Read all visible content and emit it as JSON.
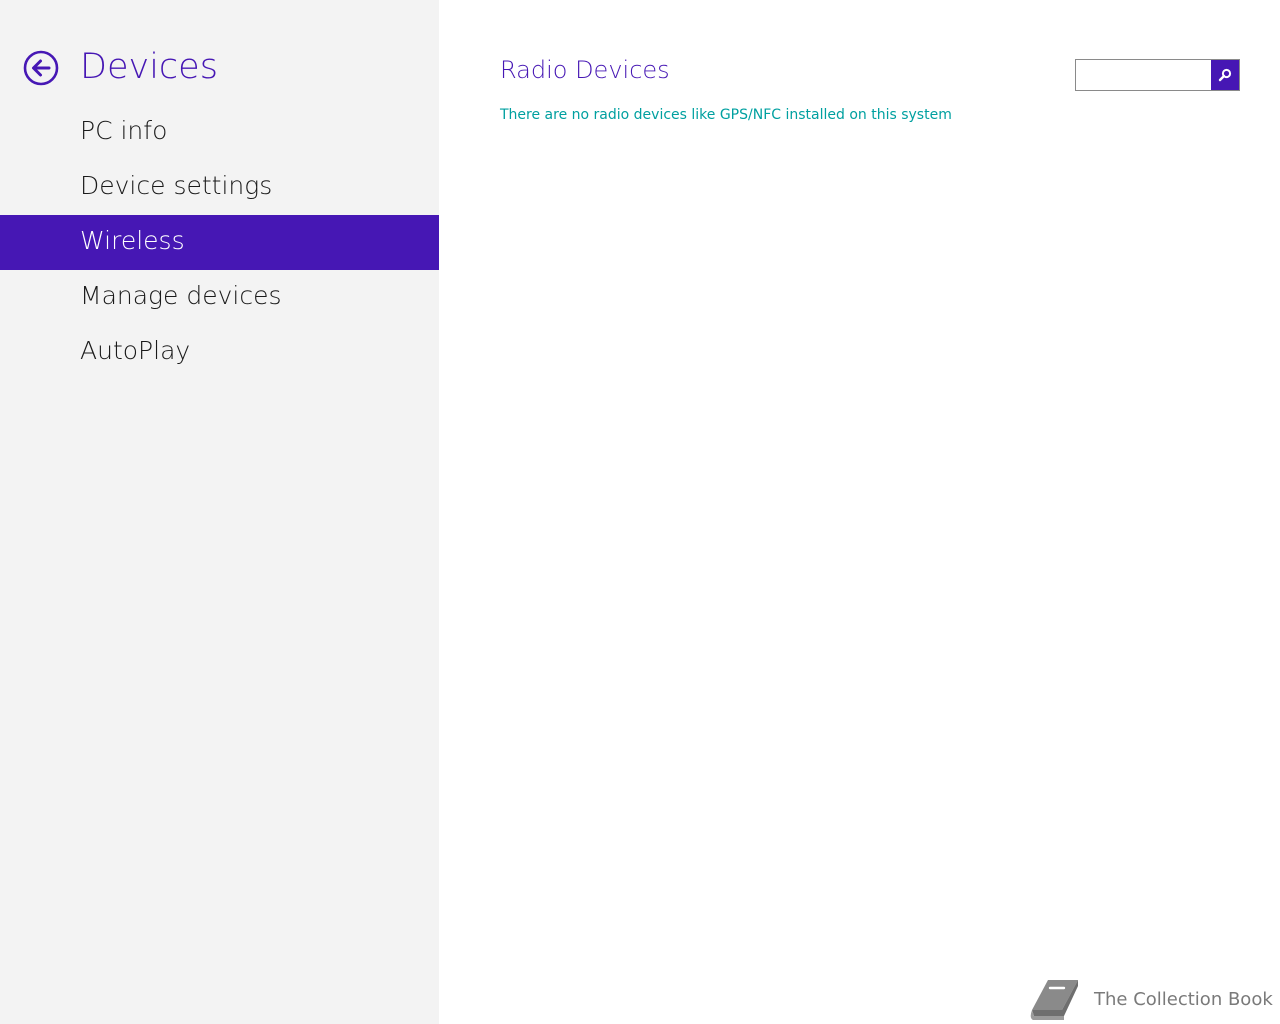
{
  "sidebar": {
    "title": "Devices",
    "back_icon": "back-arrow-circle-icon",
    "items": [
      {
        "label": "PC info",
        "selected": false
      },
      {
        "label": "Device settings",
        "selected": false
      },
      {
        "label": "Wireless",
        "selected": true
      },
      {
        "label": "Manage devices",
        "selected": false
      },
      {
        "label": "AutoPlay",
        "selected": false
      }
    ]
  },
  "main": {
    "title": "Radio Devices",
    "message": "There are no radio devices like GPS/NFC installed on this system"
  },
  "search": {
    "value": "",
    "placeholder": "",
    "icon": "search-icon"
  },
  "watermark": {
    "text": "The Collection Book",
    "icon": "book-icon"
  },
  "colors": {
    "accent": "#4617b4",
    "sidebar_bg": "#f3f3f3",
    "message_text": "#00a0a0",
    "watermark_text": "#7a7a7a"
  }
}
